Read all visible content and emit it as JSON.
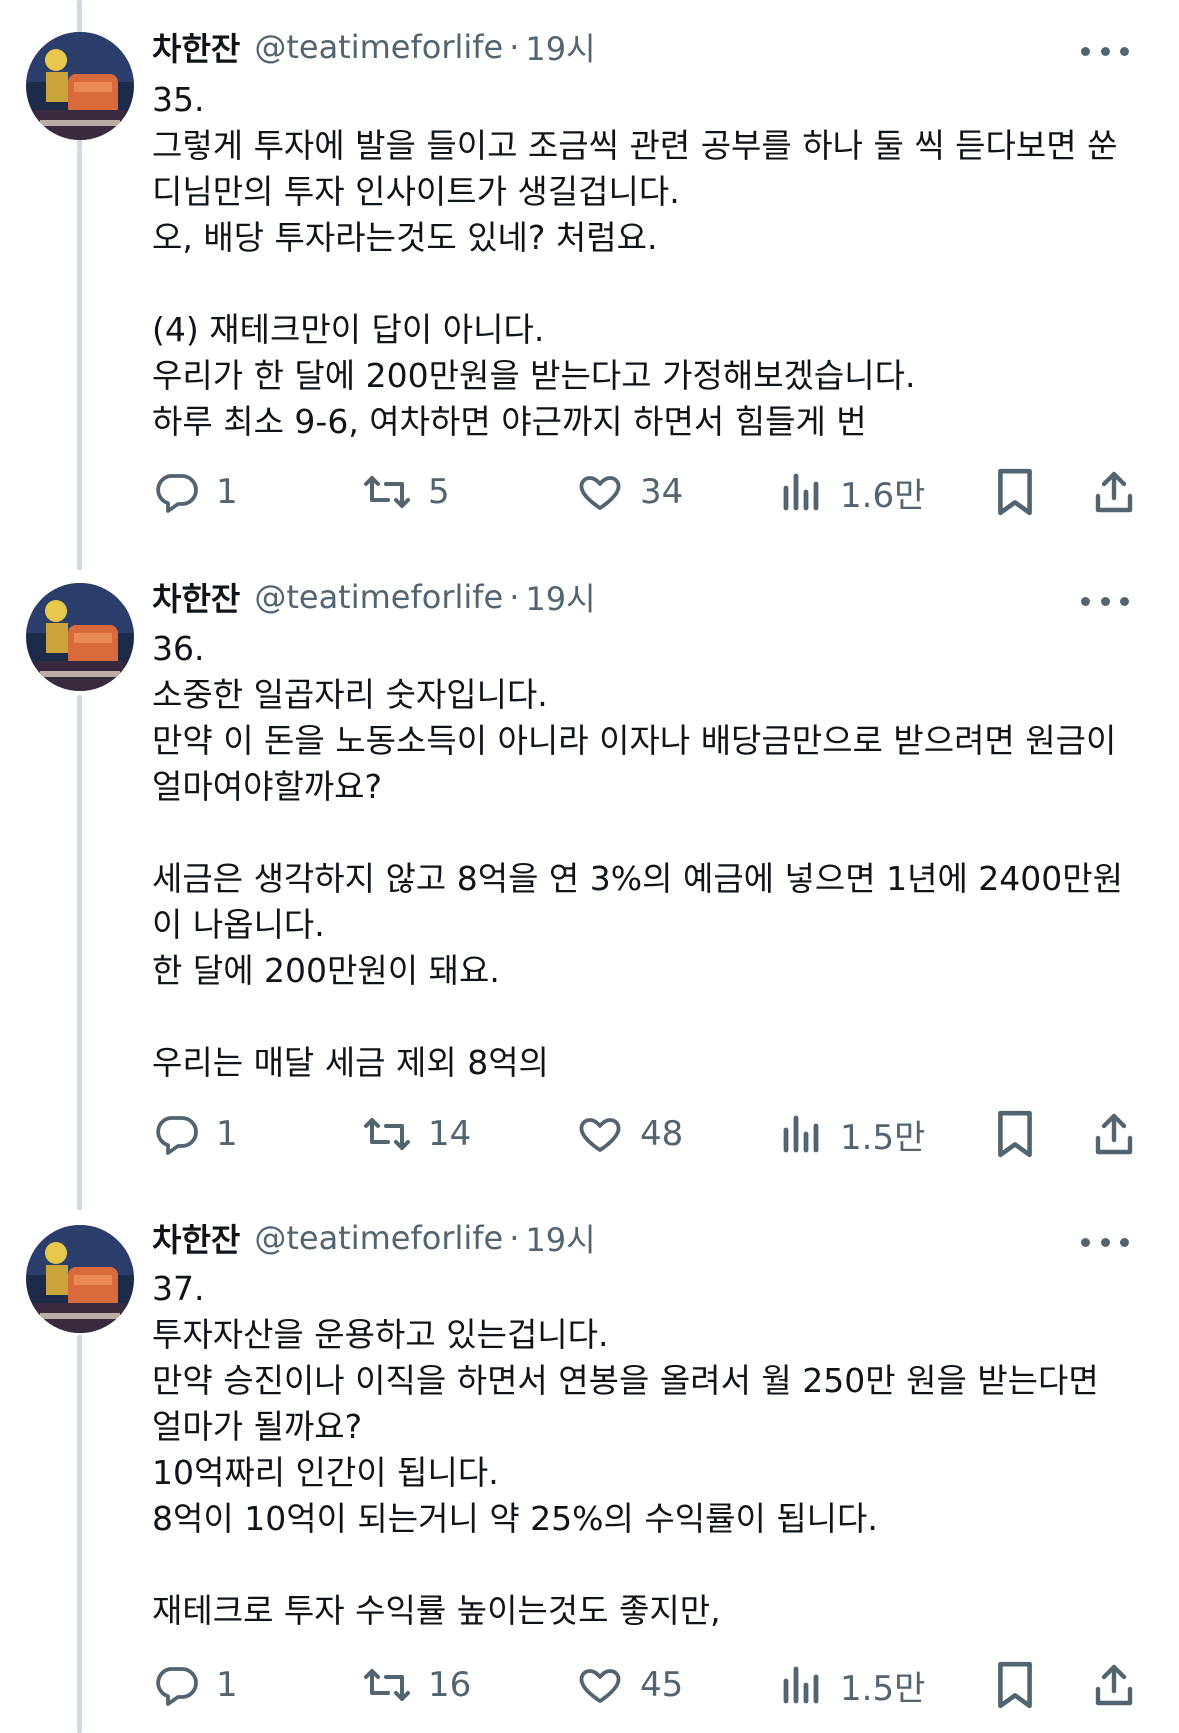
{
  "tweets": [
    {
      "name": "차한잔",
      "handle": "@teatimeforlife",
      "dot": "·",
      "time": "19시",
      "text": "35.\n그렇게 투자에 발을 들이고 조금씩 관련 공부를 하나 둘 씩 듣다보면 쑨\n디님만의 투자 인사이트가 생길겁니다.\n오, 배당 투자라는것도 있네? 처럼요.\n\n(4) 재테크만이 답이 아니다.\n우리가 한 달에 200만원을 받는다고 가정해보겠습니다.\n하루 최소 9-6, 여차하면 야근까지 하면서 힘들게 번",
      "replies": "1",
      "retweets": "5",
      "likes": "34",
      "views": "1.6만"
    },
    {
      "name": "차한잔",
      "handle": "@teatimeforlife",
      "dot": "·",
      "time": "19시",
      "text": "36.\n소중한 일곱자리 숫자입니다.\n만약 이 돈을 노동소득이 아니라 이자나 배당금만으로 받으려면 원금이\n얼마여야할까요?\n\n세금은 생각하지 않고 8억을 연 3%의 예금에 넣으면 1년에 2400만원\n이 나옵니다.\n한 달에 200만원이 돼요.\n\n우리는 매달 세금 제외 8억의",
      "replies": "1",
      "retweets": "14",
      "likes": "48",
      "views": "1.5만"
    },
    {
      "name": "차한잔",
      "handle": "@teatimeforlife",
      "dot": "·",
      "time": "19시",
      "text": "37.\n투자자산을 운용하고 있는겁니다.\n만약 승진이나 이직을 하면서 연봉을 올려서 월 250만 원을 받는다면\n얼마가 될까요?\n10억짜리 인간이 됩니다.\n8억이 10억이 되는거니 약 25%의 수익률이 됩니다.\n\n재테크로 투자 수익률 높이는것도 좋지만,",
      "replies": "1",
      "retweets": "16",
      "likes": "45",
      "views": "1.5만"
    }
  ],
  "icons": {
    "reply": "reply-icon",
    "retweet": "retweet-icon",
    "like": "heart-icon",
    "views": "views-icon",
    "bookmark": "bookmark-icon",
    "share": "share-icon",
    "more": "more-icon"
  },
  "colors": {
    "text": "#0f1419",
    "secondary": "#536471",
    "thread_line": "#cfd9de"
  }
}
